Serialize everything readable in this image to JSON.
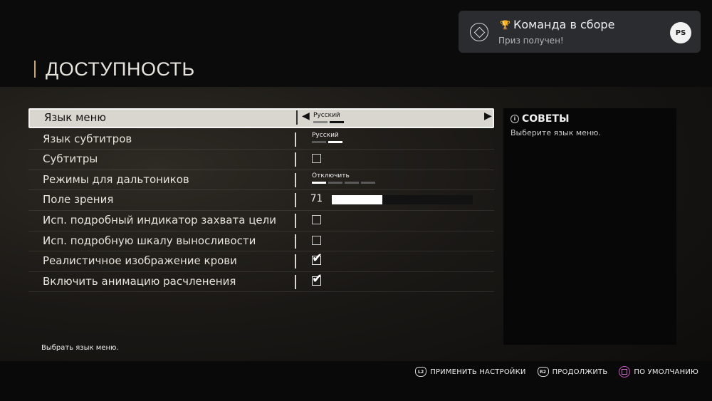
{
  "page": {
    "title": "ДОСТУПНОСТЬ"
  },
  "notification": {
    "title": "Команда в сборе",
    "subtitle": "Приз получен!",
    "trophy_icon": "trophy-icon",
    "badge_icon": "diamond-icon",
    "platform_icon": "playstation-icon",
    "platform_text": "PS"
  },
  "settings": [
    {
      "label": "Язык меню",
      "type": "selector",
      "value": "Русский",
      "segments_total": 2,
      "segment_active": 2,
      "selected": true
    },
    {
      "label": "Язык субтитров",
      "type": "selector",
      "value": "Русский",
      "segments_total": 2,
      "segment_active": 2
    },
    {
      "label": "Субтитры",
      "type": "checkbox",
      "checked": false
    },
    {
      "label": "Режимы для дальтоников",
      "type": "selector",
      "value": "Отключить",
      "segments_total": 4,
      "segment_active": 1
    },
    {
      "label": "Поле зрения",
      "type": "slider",
      "value": "71",
      "fill": 0.36
    },
    {
      "label": "Исп. подробный индикатор захвата цели",
      "type": "checkbox",
      "checked": false
    },
    {
      "label": "Исп. подробную шкалу выносливости",
      "type": "checkbox",
      "checked": false
    },
    {
      "label": "Реалистичное изображение крови",
      "type": "checkbox",
      "checked": true
    },
    {
      "label": "Включить анимацию расчленения",
      "type": "checkbox",
      "checked": true
    }
  ],
  "tips": {
    "title": "СОВЕТЫ",
    "icon_text": "i",
    "text": "Выберите язык меню."
  },
  "footer": {
    "hint": "Выбрать язык меню.",
    "actions": [
      {
        "glyph": "L2",
        "label": "ПРИМЕНИТЬ НАСТРОЙКИ",
        "icon": "l2-button-icon"
      },
      {
        "glyph": "R2",
        "label": "ПРОДОЛЖИТЬ",
        "icon": "r2-button-icon"
      },
      {
        "glyph": "",
        "label": "ПО УМОЛЧАНИЮ",
        "icon": "square-button-icon"
      }
    ]
  },
  "colors": {
    "accent": "#c8a878",
    "selected_row": "#d9d6cf",
    "square_button": "#c85ac0"
  }
}
